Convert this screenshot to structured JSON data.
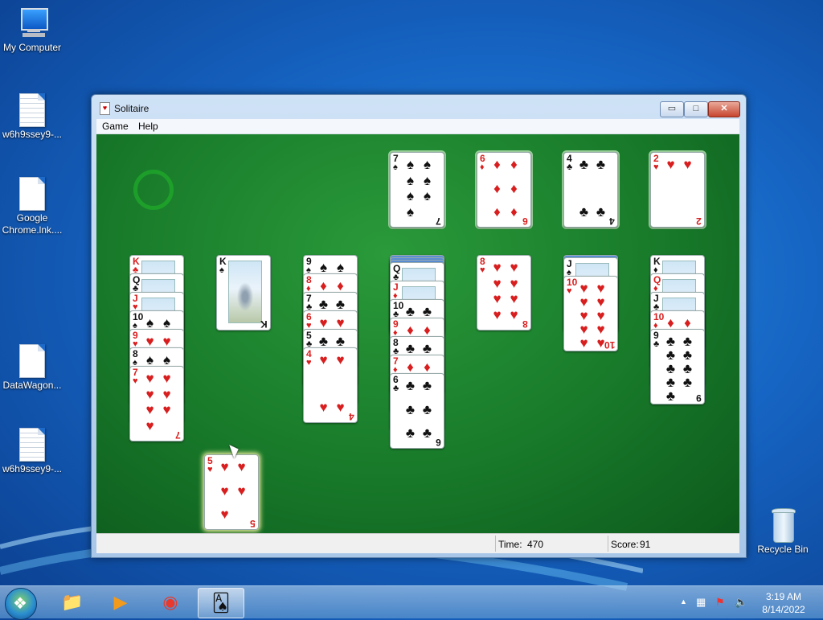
{
  "desktop": {
    "icons": [
      {
        "label": "My Computer"
      },
      {
        "label": "w6h9ssey9-..."
      },
      {
        "label": "Google Chrome.lnk...."
      },
      {
        "label": "DataWagon..."
      },
      {
        "label": "w6h9ssey9-..."
      },
      {
        "label": "Recycle Bin"
      }
    ]
  },
  "window": {
    "title": "Solitaire",
    "controls": {
      "minimize": "▭",
      "maximize": "□",
      "close": "✕"
    },
    "menu": [
      "Game",
      "Help"
    ],
    "status": {
      "time_label": "Time:",
      "time_value": "470",
      "score_label": "Score:",
      "score_value": "91"
    }
  },
  "game": {
    "foundations": [
      {
        "rank": "7",
        "suit": "♠",
        "color": "black"
      },
      {
        "rank": "6",
        "suit": "♦",
        "color": "red"
      },
      {
        "rank": "4",
        "suit": "♣",
        "color": "black"
      },
      {
        "rank": "2",
        "suit": "♥",
        "color": "red"
      }
    ],
    "tableau": [
      {
        "facedown": 0,
        "cards": [
          {
            "rank": "K",
            "suit": "♣",
            "color": "red"
          },
          {
            "rank": "Q",
            "suit": "♣",
            "color": "black"
          },
          {
            "rank": "J",
            "suit": "♥",
            "color": "red"
          },
          {
            "rank": "10",
            "suit": "♠",
            "color": "black"
          },
          {
            "rank": "9",
            "suit": "♥",
            "color": "red"
          },
          {
            "rank": "8",
            "suit": "♠",
            "color": "black"
          },
          {
            "rank": "7",
            "suit": "♥",
            "color": "red"
          }
        ]
      },
      {
        "facedown": 0,
        "cards": [
          {
            "rank": "K",
            "suit": "♠",
            "color": "black"
          }
        ]
      },
      {
        "facedown": 0,
        "cards": [
          {
            "rank": "9",
            "suit": "♠",
            "color": "black"
          },
          {
            "rank": "8",
            "suit": "♦",
            "color": "red"
          },
          {
            "rank": "7",
            "suit": "♣",
            "color": "black"
          },
          {
            "rank": "6",
            "suit": "♥",
            "color": "red"
          },
          {
            "rank": "5",
            "suit": "♣",
            "color": "black"
          },
          {
            "rank": "4",
            "suit": "♥",
            "color": "red"
          }
        ]
      },
      {
        "facedown": 3,
        "cards": [
          {
            "rank": "Q",
            "suit": "♣",
            "color": "black"
          },
          {
            "rank": "J",
            "suit": "♦",
            "color": "red"
          },
          {
            "rank": "10",
            "suit": "♣",
            "color": "black"
          },
          {
            "rank": "9",
            "suit": "♦",
            "color": "red"
          },
          {
            "rank": "8",
            "suit": "♣",
            "color": "black"
          },
          {
            "rank": "7",
            "suit": "♦",
            "color": "red"
          },
          {
            "rank": "6",
            "suit": "♣",
            "color": "black"
          }
        ]
      },
      {
        "facedown": 0,
        "cards": [
          {
            "rank": "8",
            "suit": "♥",
            "color": "red"
          }
        ]
      },
      {
        "facedown": 1,
        "cards": [
          {
            "rank": "J",
            "suit": "♠",
            "color": "black"
          },
          {
            "rank": "10",
            "suit": "♥",
            "color": "red"
          }
        ]
      },
      {
        "facedown": 0,
        "cards": [
          {
            "rank": "K",
            "suit": "♦",
            "color": "black"
          },
          {
            "rank": "Q",
            "suit": "♦",
            "color": "red"
          },
          {
            "rank": "J",
            "suit": "♣",
            "color": "black"
          },
          {
            "rank": "10",
            "suit": "♦",
            "color": "red"
          },
          {
            "rank": "9",
            "suit": "♣",
            "color": "black"
          }
        ]
      }
    ],
    "dragging": {
      "rank": "5",
      "suit": "♥",
      "color": "red"
    }
  },
  "taskbar": {
    "clock_time": "3:19 AM",
    "clock_date": "8/14/2022",
    "tray_expand": "▲",
    "apps": [
      {
        "name": "windows-explorer",
        "glyph": "📁"
      },
      {
        "name": "media-player",
        "glyph": "▶"
      },
      {
        "name": "chrome",
        "glyph": "◉"
      },
      {
        "name": "solitaire",
        "glyph": "🂡"
      }
    ]
  }
}
